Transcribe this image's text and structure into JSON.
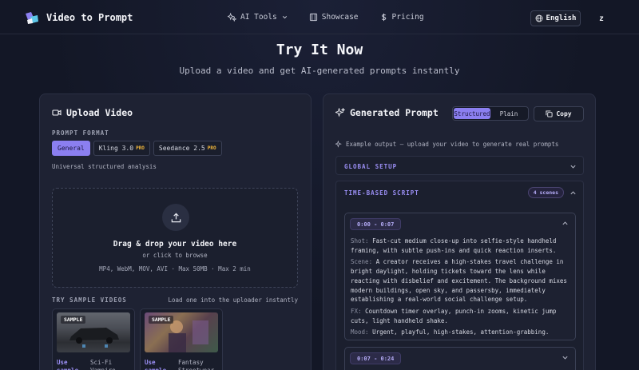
{
  "nav": {
    "brand": "Video to Prompt",
    "links": [
      {
        "label": "AI Tools",
        "icon": "sparkle-icon",
        "dropdown": true
      },
      {
        "label": "Showcase",
        "icon": "film-icon"
      },
      {
        "label": "Pricing",
        "icon": "dollar-icon"
      }
    ],
    "language": "English",
    "avatar_initial": "z"
  },
  "hero": {
    "title": "Try It Now",
    "subtitle": "Upload a video and get AI-generated prompts instantly"
  },
  "upload": {
    "title": "Upload Video",
    "prompt_format_label": "PROMPT FORMAT",
    "formats": [
      {
        "label": "General",
        "active": true,
        "pro": ""
      },
      {
        "label": "Kling 3.0",
        "active": false,
        "pro": "PRO"
      },
      {
        "label": "Seedance 2.5",
        "active": false,
        "pro": "PRO"
      }
    ],
    "format_description": "Universal structured analysis",
    "dropzone": {
      "main": "Drag & drop your video here",
      "sub": "or click to browse",
      "formats": "MP4, WebM, MOV, AVI · Max 50MB · Max 2 min"
    },
    "samples_title": "TRY SAMPLE VIDEOS",
    "samples_hint": "Load one into the uploader instantly",
    "samples": [
      {
        "badge": "SAMPLE",
        "use": "Use sample",
        "name": "Sci-Fi Vampire"
      },
      {
        "badge": "SAMPLE",
        "use": "Use sample",
        "name": "Fantasy Streetwear"
      }
    ]
  },
  "generated": {
    "title": "Generated Prompt",
    "toggle": [
      {
        "label": "Structured",
        "active": true
      },
      {
        "label": "Plain",
        "active": false
      }
    ],
    "copy_label": "Copy",
    "example_note": "Example output — upload your video to generate real prompts",
    "global_setup": "GLOBAL SETUP",
    "time_script": "TIME-BASED SCRIPT",
    "scenes_count": "4 scenes",
    "scene1": {
      "time": "0:00 - 0:07",
      "shot_key": "Shot:",
      "shot": "Fast-cut medium close-up into selfie-style handheld framing, with subtle push-ins and quick reaction inserts.",
      "scene_key": "Scene:",
      "scene": "A creator receives a high-stakes travel challenge in bright daylight, holding tickets toward the lens while reacting with disbelief and excitement. The background mixes modern buildings, open sky, and passersby, immediately establishing a real-world social challenge setup.",
      "fx_key": "FX:",
      "fx": "Countdown timer overlay, punch-in zooms, kinetic jump cuts, light handheld shake.",
      "mood_key": "Mood:",
      "mood": "Urgent, playful, high-stakes, attention-grabbing."
    },
    "scene2": {
      "time": "0:07 - 0:24"
    }
  },
  "colors": {
    "accent": "#8b7ff0",
    "pro": "#f1b73b",
    "background": "#131726",
    "panel": "#1e2233"
  }
}
